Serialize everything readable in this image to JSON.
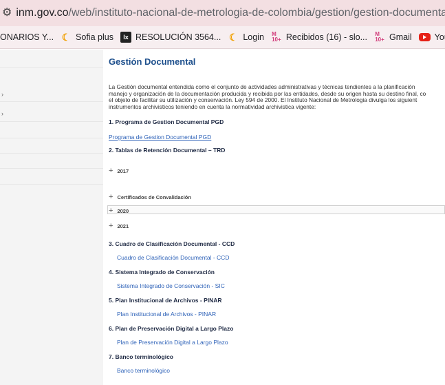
{
  "address_bar": {
    "url_host": "inm.gov.co",
    "url_path": "/web/instituto-nacional-de-metrologia-de-colombia/gestion/gestion-documental/"
  },
  "bookmarks": [
    {
      "label": "ONARIOS Y...",
      "icon": "none"
    },
    {
      "label": "Sofia plus",
      "icon": "sofia-icon"
    },
    {
      "label": "RESOLUCIÓN 3564...",
      "icon": "lx-icon"
    },
    {
      "label": "Login",
      "icon": "login-icon"
    },
    {
      "label": "Recibidos (16) - slo...",
      "icon": "gmail-icon"
    },
    {
      "label": "Gmail",
      "icon": "gmail-icon"
    },
    {
      "label": "YouTube",
      "icon": "youtube-icon"
    }
  ],
  "page": {
    "title": "Gestión Documental",
    "intro_lines": [
      "La Gestión documental entendida como el conjunto de actividades administrativas y técnicas tendientes a la planificación",
      "manejo y organización de la documentación producida y recibida por las entidades, desde su origen hasta su destino final, co",
      "el objeto de facilitar su utilización y conservación. Ley 594 de 2000. El Instituto Nacional de Metrologia divulga los siguient",
      "instrumentos archivisticos teniendo en cuenta la normatividad archivistica vigente:"
    ],
    "sections": {
      "s1_heading": "1. Programa de Gestion Documental PGD",
      "s1_link": "Programa de Gestion Documental PGD",
      "s2_heading": "2. Tablas de Retención Documental – TRD",
      "acc_2017": "2017",
      "acc_cert": "Certificados de Convalidación",
      "acc_2020": "2020",
      "acc_2021": "2021",
      "s3_heading": "3. Cuadro de Clasificación Documental - CCD",
      "s3_link": "Cuadro de Clasificación Documental - CCD",
      "s4_heading": "4. Sistema Integrado de Conservación",
      "s4_link": "Sistema Integrado de Conservación - SIC",
      "s5_heading": "5. Plan Institucional de Archivos - PINAR",
      "s5_link": "Plan Institucional de Archivos - PINAR",
      "s6_heading": "6. Plan de Preservación Digital a Largo Plazo",
      "s6_link": "Plan de Preservación Digital a Largo Plazo",
      "s7_heading": "7. Banco terminológico",
      "s7_link": "Banco terminológico"
    }
  },
  "colors": {
    "title": "#1d4f8c",
    "link": "#2e62b8",
    "address_bar_bg": "#f3dfe2"
  }
}
